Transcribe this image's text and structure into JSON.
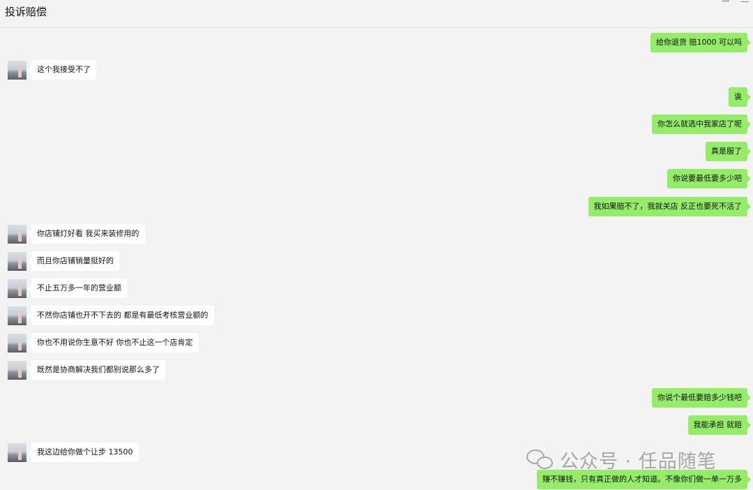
{
  "window": {
    "title": "投诉赔偿",
    "pin_icon": "ꟷ",
    "minimize_icon": "—"
  },
  "messages": [
    {
      "dir": "out",
      "text": "给你退货 赔1000  可以吗"
    },
    {
      "dir": "in",
      "text": "这个我接受不了"
    },
    {
      "dir": "out",
      "text": "诶"
    },
    {
      "dir": "out",
      "text": "你怎么就选中我家店了呢"
    },
    {
      "dir": "out",
      "text": "真是服了"
    },
    {
      "dir": "out",
      "text": "你说要最低要多少吧"
    },
    {
      "dir": "out",
      "text": "我如果赔不了，我就关店  反正也要死不活了"
    },
    {
      "dir": "in",
      "text": "你店铺灯好看 我买来装修用的"
    },
    {
      "dir": "in",
      "text": "而且你店铺销量挺好的"
    },
    {
      "dir": "in",
      "text": "不止五万多一年的营业额"
    },
    {
      "dir": "in",
      "text": "不然你店铺也开不下去的  都是有最低考核营业额的"
    },
    {
      "dir": "in",
      "text": "你也不用说你生意不好 你也不止这一个店肯定"
    },
    {
      "dir": "in",
      "text": "既然是协商解决我们都别说那么多了"
    },
    {
      "dir": "out",
      "text": "你说个最低要赔多少钱吧"
    },
    {
      "dir": "out",
      "text": "我能承担 就赔"
    },
    {
      "dir": "in",
      "text": "我这边给你做个让步  13500"
    },
    {
      "dir": "out",
      "text": "赚不赚钱，只有真正做的人才知道。不像你们做一单一万多"
    }
  ],
  "watermark": {
    "text": "公众号 · 任品随笔",
    "icon": "wechat-icon"
  },
  "colors": {
    "background": "#f3f3f3",
    "incoming_bubble": "#ffffff",
    "outgoing_bubble": "#95ec69",
    "watermark": "#a6a6a6"
  }
}
